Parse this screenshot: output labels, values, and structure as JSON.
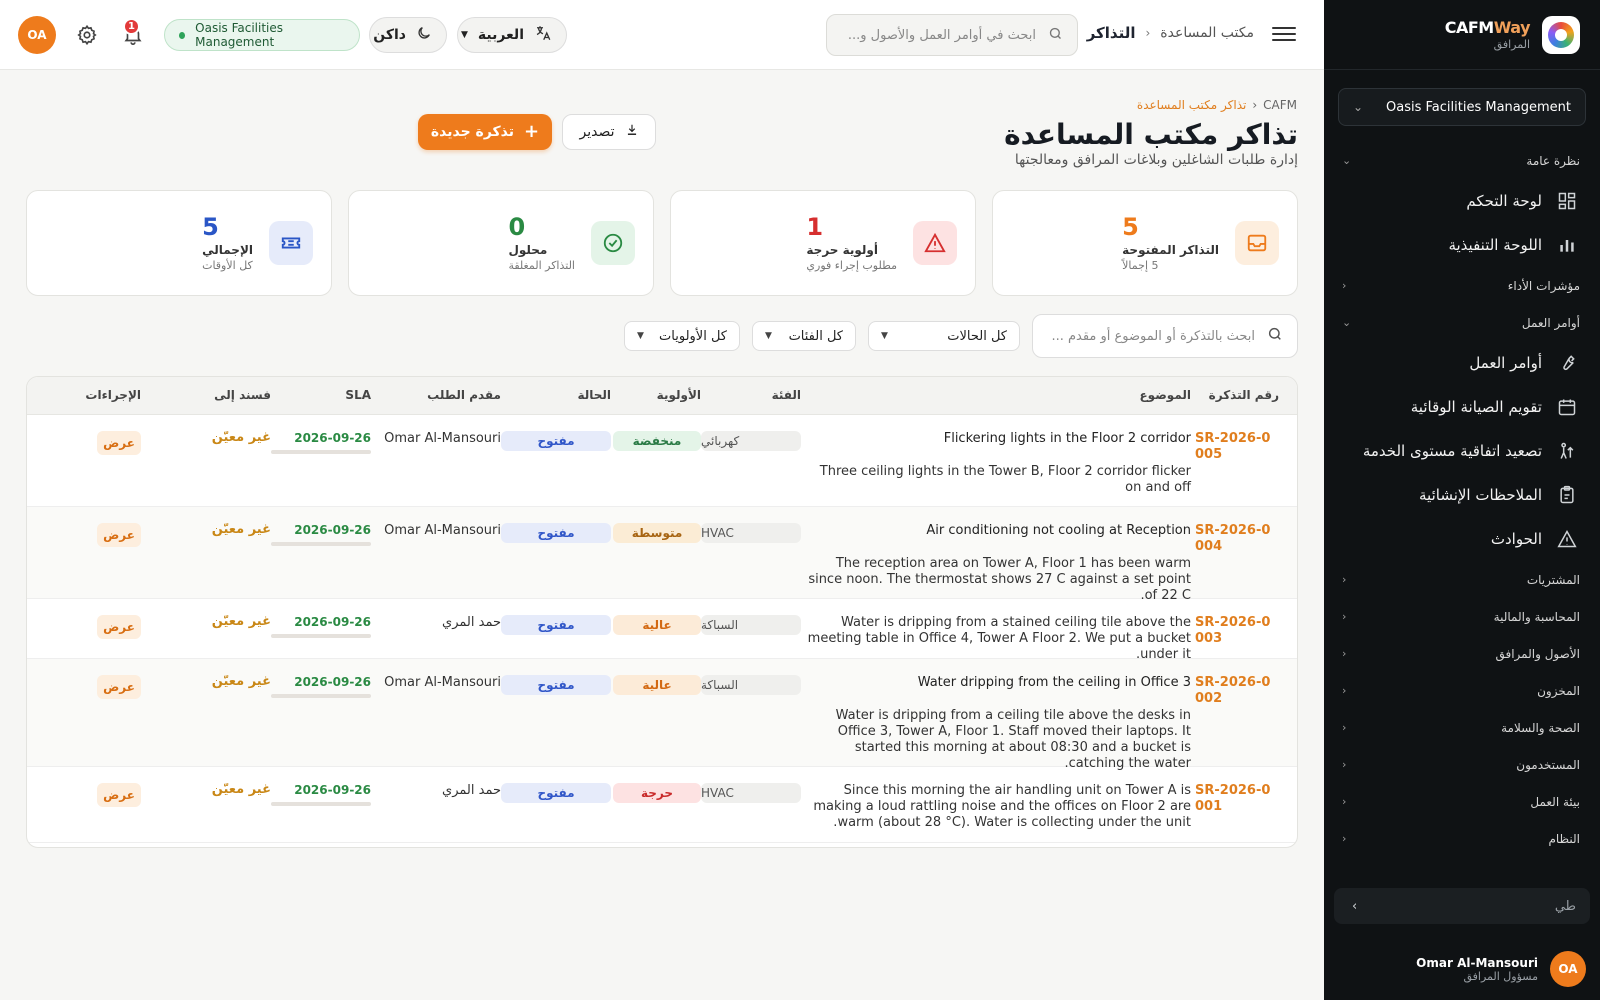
{
  "brand": {
    "name_main": "CAFM",
    "name_accent": "Way",
    "subtitle": "المرافق"
  },
  "sidebar": {
    "org": "Oasis Facilities Management",
    "items": [
      {
        "type": "section",
        "label": "نظرة عامة",
        "expanded": true
      },
      {
        "type": "item",
        "label": "لوحة التحكم",
        "icon": "dashboard-icon"
      },
      {
        "type": "item",
        "label": "اللوحة التنفيذية",
        "icon": "bar-chart-icon"
      },
      {
        "type": "section",
        "label": "مؤشرات الأداء",
        "expanded": false
      },
      {
        "type": "section",
        "label": "أوامر العمل",
        "expanded": true
      },
      {
        "type": "item",
        "label": "أوامر العمل",
        "icon": "wrench-icon"
      },
      {
        "type": "item",
        "label": "تقويم الصيانة الوقائية",
        "icon": "calendar-icon"
      },
      {
        "type": "item",
        "label": "تصعيد اتفاقية مستوى الخدمة",
        "icon": "escalation-icon"
      },
      {
        "type": "item",
        "label": "الملاحظات الإنشائية",
        "icon": "clipboard-icon"
      },
      {
        "type": "item",
        "label": "الحوادث",
        "icon": "warning-icon"
      },
      {
        "type": "section",
        "label": "المشتريات",
        "expanded": false
      },
      {
        "type": "section",
        "label": "المحاسبة والمالية",
        "expanded": false
      },
      {
        "type": "section",
        "label": "الأصول والمرافق",
        "expanded": false
      },
      {
        "type": "section",
        "label": "المخزون",
        "expanded": false
      },
      {
        "type": "section",
        "label": "الصحة والسلامة",
        "expanded": false
      },
      {
        "type": "section",
        "label": "المستخدمون",
        "expanded": false
      },
      {
        "type": "section",
        "label": "بيئة العمل",
        "expanded": false
      },
      {
        "type": "section",
        "label": "النظام",
        "expanded": false
      }
    ],
    "collapse_label": "طي",
    "user": {
      "initials": "OA",
      "name": "Omar Al-Mansouri",
      "role": "مسؤول المرافق"
    }
  },
  "topbar": {
    "breadcrumb_parent": "مكتب المساعدة",
    "breadcrumb_current": "التذاكر",
    "search_placeholder": "ابحث في أوامر العمل والأصول و...",
    "language": "العربية",
    "theme": "داكن",
    "org_badge": "Oasis Facilities Management",
    "notifications_count": "1",
    "avatar_initials": "OA"
  },
  "page": {
    "breadcrumb_root": "CAFM",
    "breadcrumb_current": "تذاكر مكتب المساعدة",
    "title": "تذاكر مكتب المساعدة",
    "subtitle": "إدارة طلبات الشاغلين وبلاغات المرافق ومعالجتها",
    "new_button": "تذكرة جديدة",
    "export_button": "تصدير"
  },
  "stats": [
    {
      "value": "5",
      "label": "التذاكر المفتوحة",
      "sub": "5 إجمالاً",
      "color": "#ee7b1c",
      "bg": "#fdeede",
      "icon": "inbox-icon"
    },
    {
      "value": "1",
      "label": "أولوية حرجة",
      "sub": "مطلوب إجراء فوري",
      "color": "#d62f2f",
      "bg": "#fde2e2",
      "icon": "alert-triangle-icon"
    },
    {
      "value": "0",
      "label": "محلول",
      "sub": "التذاكر المغلقة",
      "color": "#2a8a43",
      "bg": "#e4f4e8",
      "icon": "check-circle-icon"
    },
    {
      "value": "5",
      "label": "الإجمالي",
      "sub": "كل الأوقات",
      "color": "#2a56c6",
      "bg": "#e6ebfa",
      "icon": "ticket-icon"
    }
  ],
  "filters": {
    "search_placeholder": "ابحث بالتذكرة أو الموضوع أو مقدم ...",
    "status": "كل الحالات",
    "category": "كل الفئات",
    "priority": "كل الأولويات"
  },
  "table": {
    "headers": {
      "id": "رقم التذكرة",
      "subject": "الموضوع",
      "category": "الفئة",
      "priority": "الأولوية",
      "status": "الحالة",
      "requester": "مقدم الطلب",
      "sla": "SLA",
      "assignee": "فسند إلى",
      "actions": "الإجراءات"
    },
    "rows": [
      {
        "id": "SR-2026-0005",
        "title": "Flickering lights in the Floor 2 corridor",
        "desc": "Three ceiling lights in the Tower B, Floor 2 corridor flicker on and off",
        "category": "كهربائي",
        "priority": "منخفضة",
        "priority_level": "low",
        "status": "مفتوح",
        "requester": "Omar Al-Mansouri",
        "sla": "2026-09-26",
        "assignee": "غير معيّن",
        "action": "عرض"
      },
      {
        "id": "SR-2026-0004",
        "title": "Air conditioning not cooling at Reception",
        "desc": "The reception area on Tower A, Floor 1 has been warm since noon. The thermostat shows 27 C against a set point of 22 C.",
        "category": "HVAC",
        "priority": "متوسطة",
        "priority_level": "medium",
        "status": "مفتوح",
        "requester": "Omar Al-Mansouri",
        "sla": "2026-09-26",
        "assignee": "غير معيّن",
        "action": "عرض"
      },
      {
        "id": "SR-2026-0003",
        "title": "",
        "desc": "Water is dripping from a stained ceiling tile above the meeting table in Office 4, Tower A Floor 2. We put a bucket under it.",
        "category": "السباكة",
        "priority": "عالية",
        "priority_level": "high",
        "status": "مفتوح",
        "requester": "حمد المري",
        "sla": "2026-09-26",
        "assignee": "غير معيّن",
        "action": "عرض"
      },
      {
        "id": "SR-2026-0002",
        "title": "Water dripping from the ceiling in Office 3",
        "desc": "Water is dripping from a ceiling tile above the desks in Office 3, Tower A, Floor 1. Staff moved their laptops. It started this morning at about 08:30 and a bucket is catching the water.",
        "category": "السباكة",
        "priority": "عالية",
        "priority_level": "high",
        "status": "مفتوح",
        "requester": "Omar Al-Mansouri",
        "sla": "2026-09-26",
        "assignee": "غير معيّن",
        "action": "عرض"
      },
      {
        "id": "SR-2026-0001",
        "title": "",
        "desc": "Since this morning the air handling unit on Tower A is making a loud rattling noise and the offices on Floor 2 are warm (about 28 °C). Water is collecting under the unit.",
        "category": "HVAC",
        "priority": "حرجة",
        "priority_level": "critical",
        "status": "مفتوح",
        "requester": "حمد المري",
        "sla": "2026-09-26",
        "assignee": "غير معيّن",
        "action": "عرض"
      }
    ]
  }
}
